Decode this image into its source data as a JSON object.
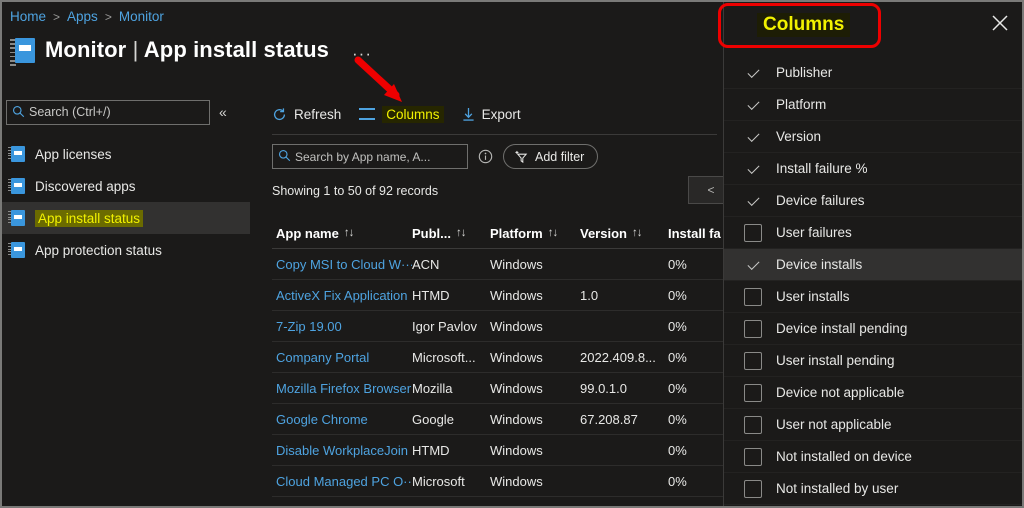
{
  "breadcrumb": {
    "items": [
      "Home",
      "Apps",
      "Monitor"
    ]
  },
  "header": {
    "title_main": "Monitor",
    "title_sep": "|",
    "title_sub": "App install status",
    "more_label": "···",
    "icon": "notebook-icon"
  },
  "left_nav": {
    "search": {
      "placeholder": "Search (Ctrl+/)",
      "value": "",
      "icon": "search-icon"
    },
    "collapse_label": "«",
    "items": [
      {
        "label": "App licenses",
        "selected": false,
        "icon": "notebook-icon"
      },
      {
        "label": "Discovered apps",
        "selected": false,
        "icon": "notebook-icon"
      },
      {
        "label": "App install status",
        "selected": true,
        "icon": "notebook-icon"
      },
      {
        "label": "App protection status",
        "selected": false,
        "icon": "notebook-icon"
      }
    ]
  },
  "toolbar": {
    "refresh_label": "Refresh",
    "refresh_icon": "refresh-icon",
    "columns_label": "Columns",
    "columns_icon": "columns-icon",
    "export_label": "Export",
    "export_icon": "download-icon"
  },
  "filters": {
    "search": {
      "placeholder": "Search by App name, A...",
      "value": "",
      "icon": "search-icon"
    },
    "info_icon": "info-icon",
    "add_filter_label": "Add filter",
    "add_filter_icon": "add-filter-icon"
  },
  "table": {
    "records_text": "Showing 1 to 50 of 92 records",
    "pager_prev_label": "<",
    "sort_glyph": "↑↓",
    "columns": [
      "App name",
      "Publ...",
      "Platform",
      "Version",
      "Install fa"
    ],
    "rows": [
      {
        "app": "Copy MSI to Cloud W···",
        "publisher": "ACN",
        "platform": "Windows",
        "version": "",
        "install_failure": "0%"
      },
      {
        "app": "ActiveX Fix Application",
        "publisher": "HTMD",
        "platform": "Windows",
        "version": "1.0",
        "install_failure": "0%"
      },
      {
        "app": "7-Zip 19.00",
        "publisher": "Igor Pavlov",
        "platform": "Windows",
        "version": "",
        "install_failure": "0%"
      },
      {
        "app": "Company Portal",
        "publisher": "Microsoft...",
        "platform": "Windows",
        "version": "2022.409.8...",
        "install_failure": "0%"
      },
      {
        "app": "Mozilla Firefox Browser",
        "publisher": "Mozilla",
        "platform": "Windows",
        "version": "99.0.1.0",
        "install_failure": "0%"
      },
      {
        "app": "Google Chrome",
        "publisher": "Google",
        "platform": "Windows",
        "version": "67.208.87",
        "install_failure": "0%"
      },
      {
        "app": "Disable WorkplaceJoin",
        "publisher": "HTMD",
        "platform": "Windows",
        "version": "",
        "install_failure": "0%"
      },
      {
        "app": "Cloud Managed PC O···",
        "publisher": "Microsoft",
        "platform": "Windows",
        "version": "",
        "install_failure": "0%"
      }
    ]
  },
  "columns_panel": {
    "title": "Columns",
    "close_icon": "close-icon",
    "items": [
      {
        "label": "Publisher",
        "checked": true,
        "hover": false
      },
      {
        "label": "Platform",
        "checked": true,
        "hover": false
      },
      {
        "label": "Version",
        "checked": true,
        "hover": false
      },
      {
        "label": "Install failure %",
        "checked": true,
        "hover": false
      },
      {
        "label": "Device failures",
        "checked": true,
        "hover": false
      },
      {
        "label": "User failures",
        "checked": false,
        "hover": false
      },
      {
        "label": "Device installs",
        "checked": true,
        "hover": true
      },
      {
        "label": "User installs",
        "checked": false,
        "hover": false
      },
      {
        "label": "Device install pending",
        "checked": false,
        "hover": false
      },
      {
        "label": "User install pending",
        "checked": false,
        "hover": false
      },
      {
        "label": "Device not applicable",
        "checked": false,
        "hover": false
      },
      {
        "label": "User not applicable",
        "checked": false,
        "hover": false
      },
      {
        "label": "Not installed on device",
        "checked": false,
        "hover": false
      },
      {
        "label": "Not installed by user",
        "checked": false,
        "hover": false
      }
    ]
  },
  "annotations": {
    "highlight_color": "#ee0000",
    "accent_color": "#4ea3e0",
    "highlight_text_color": "#f2f200",
    "box_target": "Columns",
    "arrow_target": "Columns"
  }
}
